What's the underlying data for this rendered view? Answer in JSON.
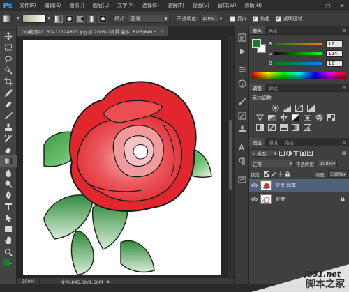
{
  "app": {
    "logo": "Ps"
  },
  "menubar": {
    "items": [
      "文件(F)",
      "编辑(E)",
      "图像(I)",
      "图层(L)",
      "文字(Y)",
      "选择(S)",
      "滤镜(T)",
      "视图(V)",
      "窗口(W)",
      "帮助(H)"
    ],
    "window_controls": [
      "–",
      "□",
      "✕"
    ]
  },
  "options": {
    "mode_label": "模式:",
    "mode_value": "正常",
    "opacity_label": "不透明度:",
    "opacity_value": "40%",
    "checks": [
      {
        "label": "反向",
        "checked": false
      },
      {
        "label": "仿色",
        "checked": true
      },
      {
        "label": "透明区域",
        "checked": true
      }
    ]
  },
  "document": {
    "tab_title": "QQ截图20160411124813.jpg @ 200% (背景 副本, RGB/8#) *",
    "tab_close": "×",
    "zoom": "200%",
    "doc_info": "文档:845.6K/1.56M",
    "status_arrow": "▶"
  },
  "color_panel": {
    "tabs": [
      "颜色",
      "色板"
    ],
    "fg_color": "#1e7a2a",
    "bg_color": "#ffffff",
    "channels": [
      {
        "label": "R",
        "value": "12"
      },
      {
        "label": "G",
        "value": "124"
      },
      {
        "label": "B",
        "value": "12"
      }
    ]
  },
  "adjust_panel": {
    "tabs": [
      "调整",
      "样式"
    ],
    "title": "添加调整"
  },
  "layers_panel": {
    "tabs": [
      "图层",
      "通道",
      "路径"
    ],
    "filter_value": "ρ 类型",
    "blend_mode": "正常",
    "opacity_label": "不透明度:",
    "opacity_value": "100%",
    "lock_label": "锁定:",
    "fill_label": "填充:",
    "fill_value": "100%",
    "layers": [
      {
        "name": "背景 副本",
        "selected": true,
        "locked": false
      },
      {
        "name": "背景",
        "selected": false,
        "locked": true
      }
    ]
  },
  "watermark": {
    "site": "jb51.net",
    "brand": "脚本之家"
  }
}
